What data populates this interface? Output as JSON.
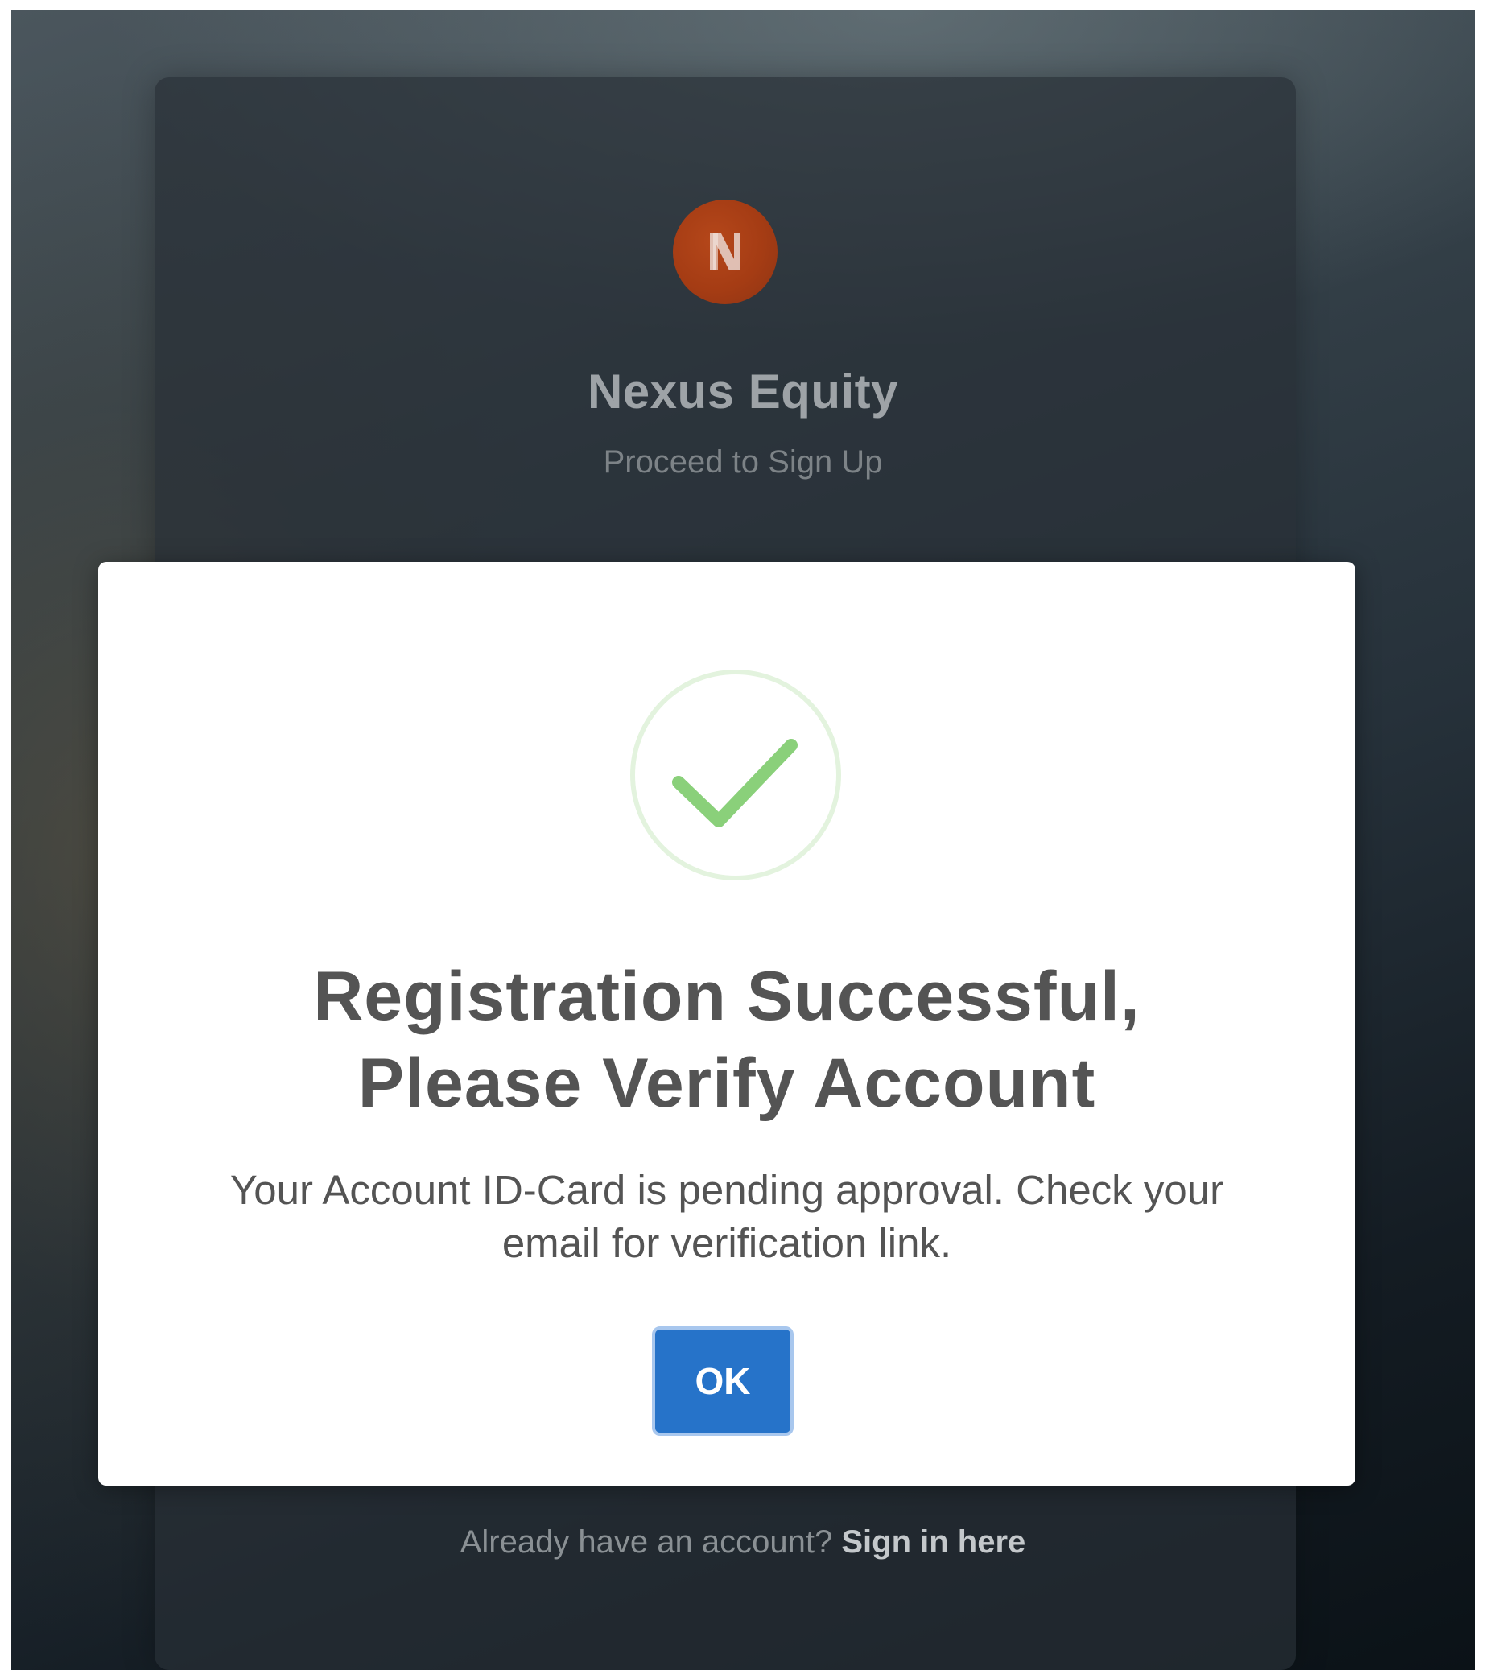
{
  "brand": {
    "name": "Nexus Equity",
    "subtitle": "Proceed to Sign Up",
    "logo_icon": "nexus-n-logo",
    "logo_color": "#a53c14"
  },
  "modal": {
    "icon": "check-icon",
    "icon_color": "#8ad07a",
    "title_line1": "Registration Successful,",
    "title_line2": "Please Verify Account",
    "message": "Your Account ID-Card is pending approval. Check your email for verification link.",
    "ok_label": "OK",
    "button_color": "#2673c9"
  },
  "footer": {
    "prompt": "Already have an account?",
    "link_label": "Sign in here"
  }
}
